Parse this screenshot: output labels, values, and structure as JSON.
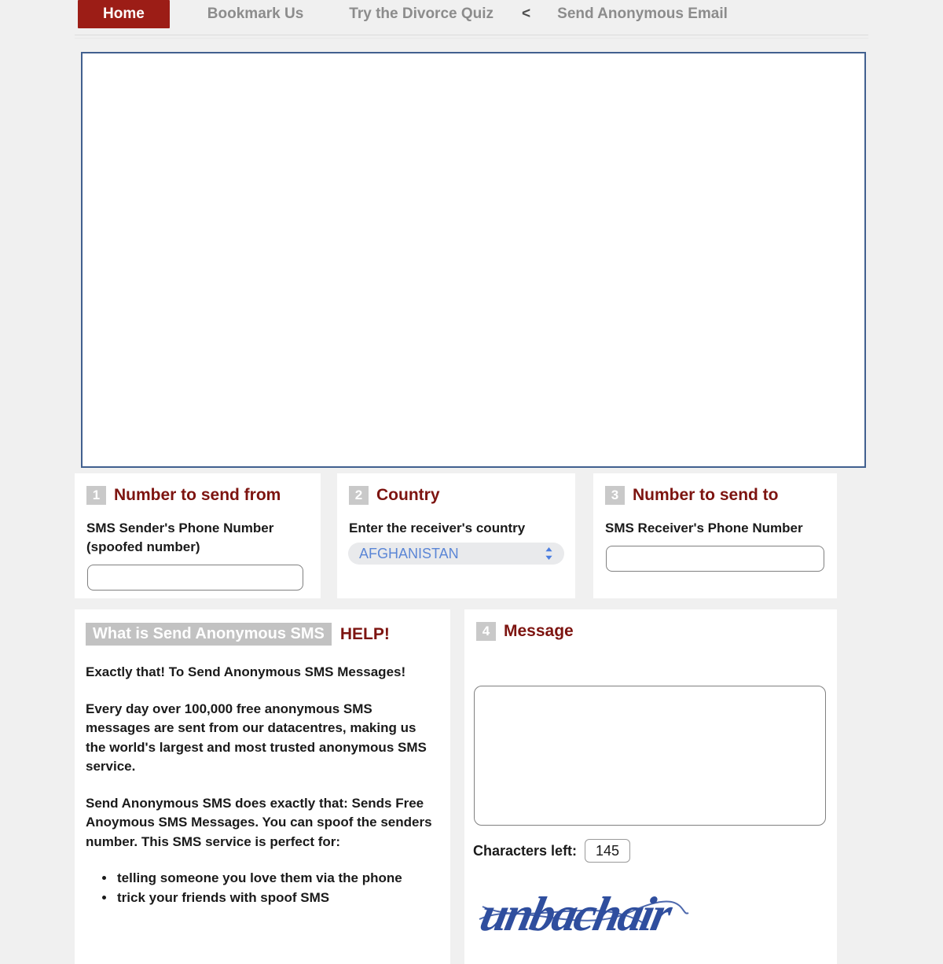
{
  "nav": {
    "items": [
      {
        "label": "Home",
        "active": true
      },
      {
        "label": "Bookmark Us",
        "active": false
      },
      {
        "label": "Try the Divorce Quiz",
        "active": false
      },
      {
        "label": "Send Anonymous Email",
        "active": false
      }
    ],
    "separator": "<"
  },
  "colors": {
    "brand_red": "#9c1d16",
    "heading_red": "#7d1410",
    "badge_gray": "#c9c9c9",
    "frame_blue": "#41608f",
    "select_text_blue": "#5b86d6",
    "page_bg": "#f0f0f0",
    "captcha_blue": "#2f4e9e"
  },
  "embed": {
    "content": ""
  },
  "steps": [
    {
      "number": "1",
      "title": "Number to send from",
      "field_label": "SMS Sender's Phone Number (spoofed number)",
      "value": "",
      "placeholder": ""
    },
    {
      "number": "2",
      "title": "Country",
      "field_label": "Enter the receiver's country",
      "selected_option": "AFGHANISTAN",
      "options": [
        "AFGHANISTAN"
      ]
    },
    {
      "number": "3",
      "title": "Number to send to",
      "field_label": "SMS Receiver's Phone Number",
      "value": "",
      "placeholder": ""
    }
  ],
  "help": {
    "badge": "What is Send Anonymous SMS",
    "title": "HELP!",
    "paragraphs": [
      "Exactly that! To Send Anonymous SMS Messages!",
      "Every day over 100,000 free anonymous SMS messages are sent from our datacentres, making us the world's largest and most trusted anonymous SMS service.",
      "Send Anonymous SMS does exactly that: Sends Free Anoymous SMS Messages. You can spoof the senders number. This SMS service is perfect for:"
    ],
    "bullets": [
      "telling someone you love them via the phone",
      "trick your friends with spoof SMS"
    ]
  },
  "message": {
    "number": "4",
    "title": "Message",
    "value": "",
    "placeholder": "",
    "chars_left_label": "Characters left:",
    "chars_left_value": "145",
    "captcha_text": "unbachair"
  }
}
